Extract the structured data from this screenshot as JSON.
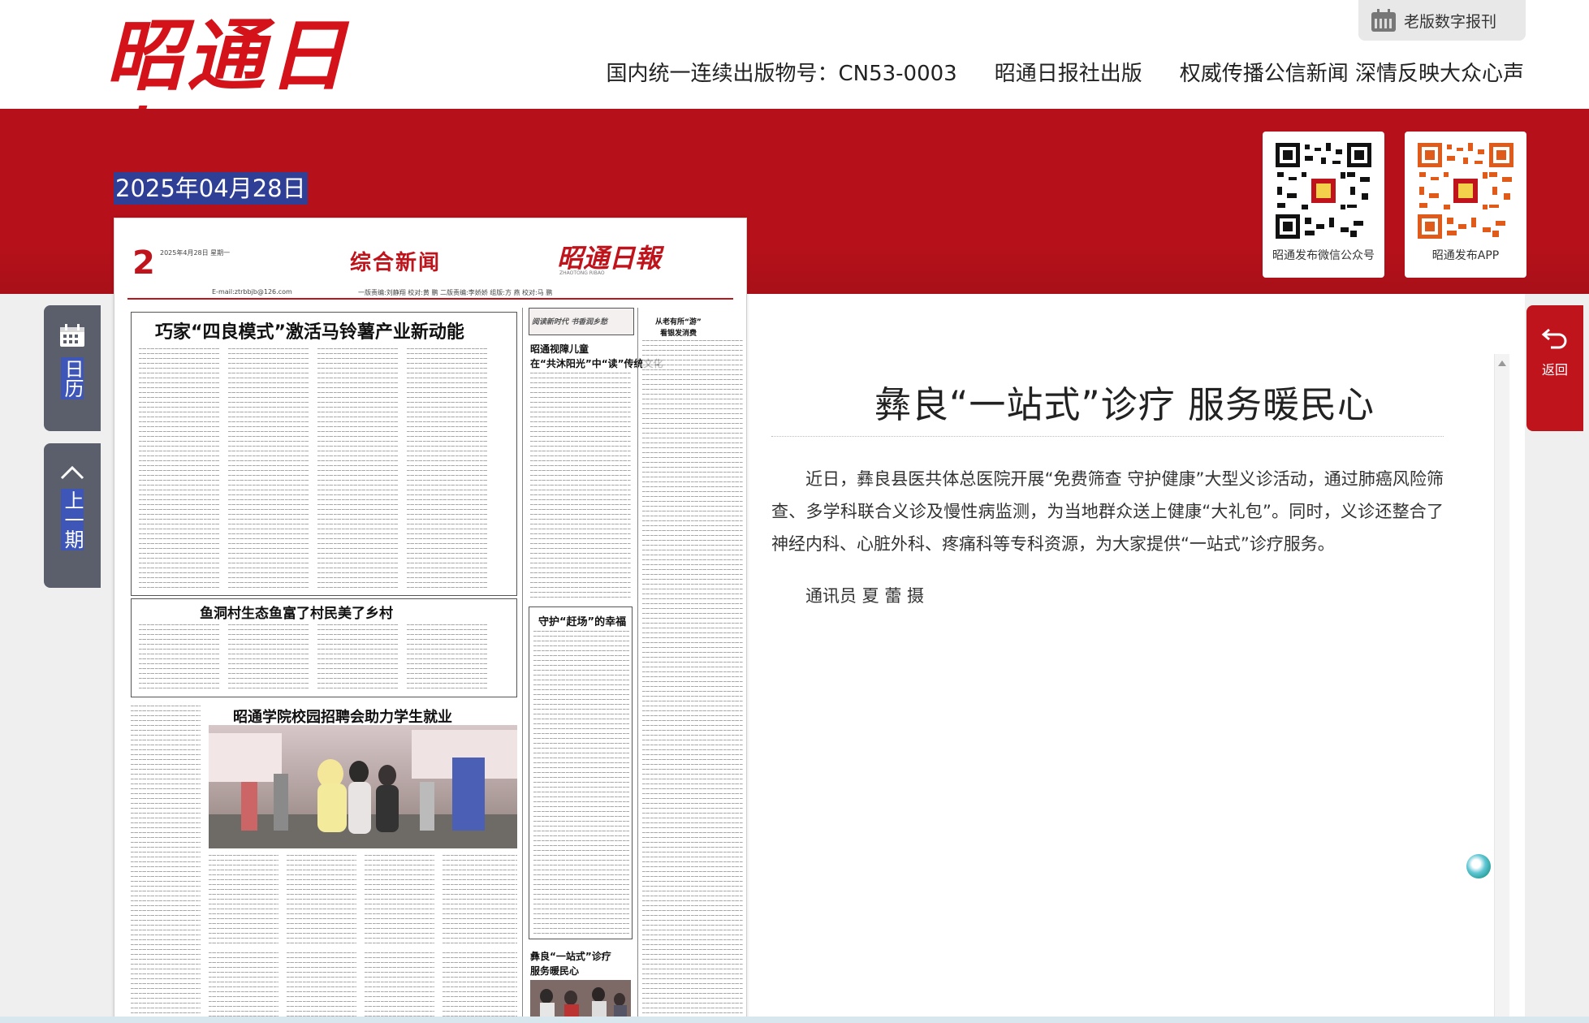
{
  "header": {
    "logo_text": "昭通日報",
    "old_version_label": "老版数字报刊",
    "publication_number": "国内统一连续出版物号：CN53-0003",
    "publisher": "昭通日报社出版",
    "slogan": "权威传播公信新闻 深情反映大众心声"
  },
  "date": "2025年04月28日",
  "qr_codes": [
    {
      "caption": "昭通发布微信公众号",
      "icon": "qr-code-icon"
    },
    {
      "caption": "昭通发布APP",
      "icon": "qr-code-icon"
    }
  ],
  "side_nav": {
    "calendar_label": "日历",
    "prev_issue_label": "上一期",
    "back_label": "返回"
  },
  "newspaper_page": {
    "page_number": "2",
    "page_date": "2025年4月28日 星期一",
    "section": "综合新闻",
    "masthead": "昭通日報",
    "masthead_sub": "ZHAOTONG RIBAO",
    "email": "E-mail:ztrbbjb@126.com",
    "credits": "一版责编:刘静翔  校对:黄 鹏  二版责编:李娇娇  组版:方 燕  校对:马 鹏",
    "headlines": {
      "h1": "巧家“四良模式”激活马铃薯产业新动能",
      "h2": "鱼洞村生态鱼富了村民美了乡村",
      "h3": "昭通学院校园招聘会助力学生就业",
      "col_banner": "阅读新时代  书香润乡愁",
      "col_h1": "昭通视障儿童",
      "col_h2": "在“共沐阳光”中“读”传统文化",
      "col_h3": "守护“赶场”的幸福",
      "col_h4": "彝良“一站式”诊疗",
      "col_h5": "服务暖民心",
      "right_col_h1": "从老有所“游”",
      "right_col_h2": "看银发消费"
    }
  },
  "article": {
    "title": "彝良“一站式”诊疗 服务暖民心",
    "body": "近日，彝良县医共体总医院开展“免费筛查 守护健康”大型义诊活动，通过肺癌风险筛查、多学科联合义诊及慢性病监测，为当地群众送上健康“大礼包”。同时，义诊还整合了神经内科、心脏外科、疼痛科等专科资源，为大家提供“一站式”诊疗服务。",
    "credit": "通讯员 夏 蕾 摄"
  },
  "colors": {
    "brand_red": "#b6111a",
    "date_highlight": "#2f3f95",
    "side_button": "#5a5f6b"
  }
}
